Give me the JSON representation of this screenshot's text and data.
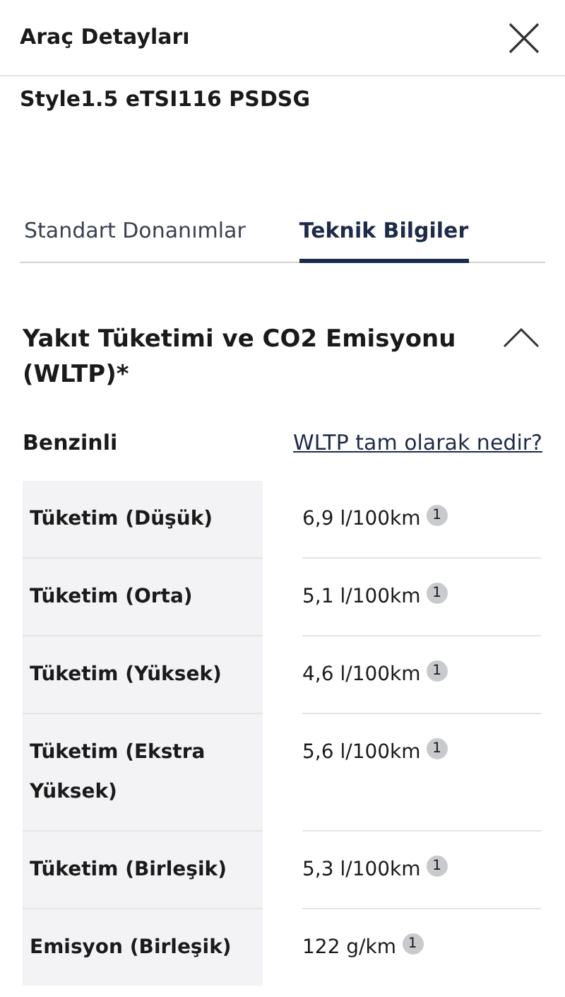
{
  "header": {
    "title": "Araç Detayları"
  },
  "model": "Style1.5 eTSI116 PSDSG",
  "tabs": [
    {
      "label": "Standart Donanımlar",
      "selected": false
    },
    {
      "label": "Teknik Bilgiler",
      "selected": true
    }
  ],
  "section": {
    "title": "Yakıt Tüketimi ve CO2 Emisyonu (WLTP)*",
    "expanded": true,
    "fuel": "Benzinli",
    "link": "WLTP tam olarak nedir?",
    "rows": [
      {
        "label": "Tüketim (Düşük)",
        "value": "6,9 l/100km",
        "note": "1"
      },
      {
        "label": "Tüketim (Orta)",
        "value": "5,1 l/100km",
        "note": "1"
      },
      {
        "label": "Tüketim (Yüksek)",
        "value": "4,6 l/100km",
        "note": "1"
      },
      {
        "label": "Tüketim (Ekstra Yüksek)",
        "value": "5,6 l/100km",
        "note": "1"
      },
      {
        "label": "Tüketim (Birleşik)",
        "value": "5,3 l/100km",
        "note": "1"
      },
      {
        "label": "Emisyon (Birleşik)",
        "value": "122 g/km",
        "note": "1"
      }
    ]
  }
}
